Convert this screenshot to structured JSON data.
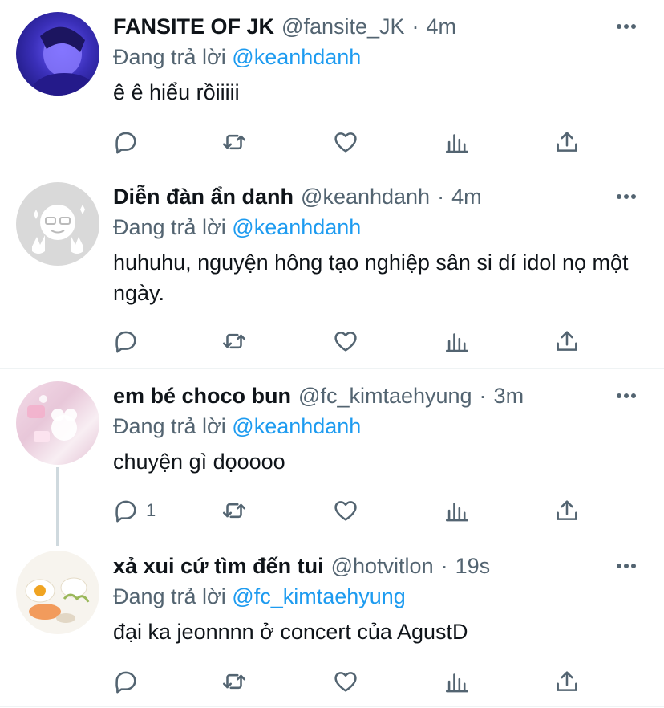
{
  "tweets": [
    {
      "name": "FANSITE OF JK",
      "handle": "@fansite_JK",
      "dot": "·",
      "time": "4m",
      "reply_prefix": "Đang trả lời",
      "reply_to": "@keanhdanh",
      "text": "ê ê hiểu rồiiiii",
      "reply_count": ""
    },
    {
      "name": "Diễn đàn ẩn danh",
      "handle": "@keanhdanh",
      "dot": "·",
      "time": "4m",
      "reply_prefix": "Đang trả lời",
      "reply_to": "@keanhdanh",
      "text": "huhuhu, nguyện hông tạo nghiệp sân si dí idol nọ một ngày.",
      "reply_count": ""
    },
    {
      "name": "em bé choco bun",
      "handle": "@fc_kimtaehyung",
      "dot": "·",
      "time": "3m",
      "reply_prefix": "Đang trả lời",
      "reply_to": "@keanhdanh",
      "text": "chuyện gì dọoooo",
      "reply_count": "1"
    },
    {
      "name": "xả xui cứ tìm đến tui",
      "handle": "@hotvitlon",
      "dot": "·",
      "time": "19s",
      "reply_prefix": "Đang trả lời",
      "reply_to": "@fc_kimtaehyung",
      "text": "đại ka jeonnnn ở concert của AgustD",
      "reply_count": ""
    }
  ],
  "icons": {
    "more": "more-horizontal-icon",
    "reply": "reply-icon",
    "retweet": "retweet-icon",
    "like": "heart-icon",
    "views": "analytics-icon",
    "share": "share-icon"
  },
  "colors": {
    "accent": "#1d9bf0",
    "muted": "#536471",
    "divider": "#eff3f4",
    "thread_line": "#cfd9de"
  }
}
